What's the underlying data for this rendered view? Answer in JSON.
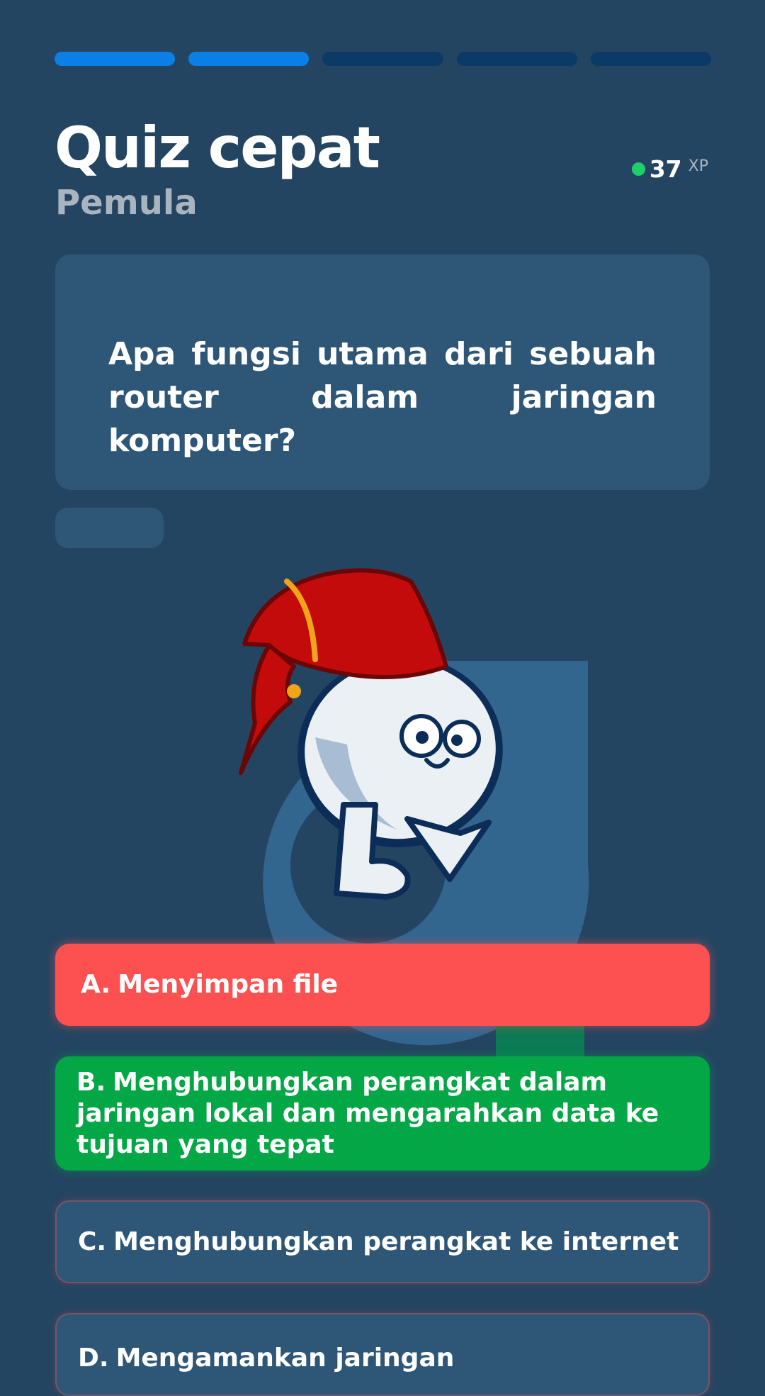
{
  "progress": {
    "current": 2,
    "total": 5
  },
  "header": {
    "title": "Quiz cepat",
    "subtitle": "Pemula"
  },
  "xp": {
    "value": "37",
    "unit": "XP",
    "dot_color": "#1fcf6a"
  },
  "question": {
    "text": "Apa fungsi utama dari sebuah router dalam jaringan komputer?"
  },
  "mascot": {
    "icon": "mascot-icon",
    "description_icon": "red-bandana-character-icon"
  },
  "options": [
    {
      "letter": "A.",
      "text": "Menyimpan file",
      "state": "wrong",
      "color": "#fd5050"
    },
    {
      "letter": "B.",
      "text": "Menghubungkan perangkat dalam jaringan lokal dan mengarahkan data ke tujuan yang tepat",
      "state": "correct",
      "color": "#04a745"
    },
    {
      "letter": "C.",
      "text": "Menghubungkan perangkat ke internet",
      "state": "default",
      "color": "#2e5677"
    },
    {
      "letter": "D.",
      "text": "Mengamankan jaringan",
      "state": "default",
      "color": "#2e5677"
    }
  ],
  "colors": {
    "background": "#244561",
    "card": "#2e5677",
    "progress_active": "#0a7fe6",
    "progress_inactive": "#0c3a67"
  }
}
